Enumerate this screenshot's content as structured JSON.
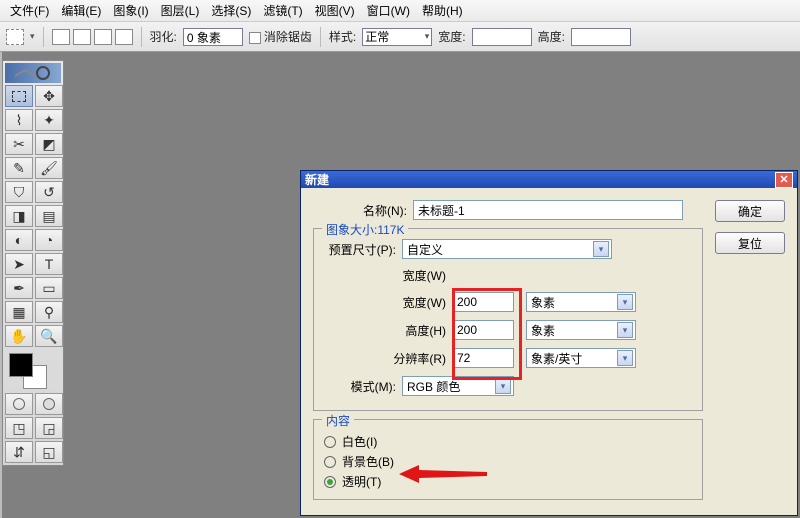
{
  "menu": [
    "文件(F)",
    "编辑(E)",
    "图象(I)",
    "图层(L)",
    "选择(S)",
    "滤镜(T)",
    "视图(V)",
    "窗口(W)",
    "帮助(H)"
  ],
  "options": {
    "feather_label": "羽化:",
    "feather_value": "0 象素",
    "antialias": "消除锯齿",
    "style_label": "样式:",
    "style_value": "正常",
    "width_label": "宽度:",
    "height_label": "高度:"
  },
  "dialog": {
    "title": "新建",
    "name_label": "名称(N):",
    "name_value": "未标题-1",
    "ok": "确定",
    "reset": "复位",
    "imagesize_legend": "图象大小:117K",
    "preset_label": "预置尺寸(P):",
    "preset_value": "自定义",
    "width_label": "宽度(W)",
    "width_value": "200",
    "width_unit": "象素",
    "height_label": "高度(H)",
    "height_value": "200",
    "height_unit": "象素",
    "res_label": "分辨率(R)",
    "res_value": "72",
    "res_unit": "象素/英寸",
    "mode_label": "模式(M):",
    "mode_value": "RGB 颜色",
    "contents_legend": "内容",
    "contents_white": "白色(I)",
    "contents_bg": "背景色(B)",
    "contents_transparent": "透明(T)"
  },
  "tool_icons": [
    "▭",
    "▶",
    "◫",
    "✦",
    "✂",
    "◩",
    "✎",
    "⌫",
    "✏",
    "▧",
    "◧",
    "▤",
    "◐",
    "◔",
    "⬈",
    ".",
    "▶",
    "T",
    "◧",
    "▭",
    "◢",
    "◯",
    "✋",
    "🔍",
    "◧",
    "▥"
  ]
}
